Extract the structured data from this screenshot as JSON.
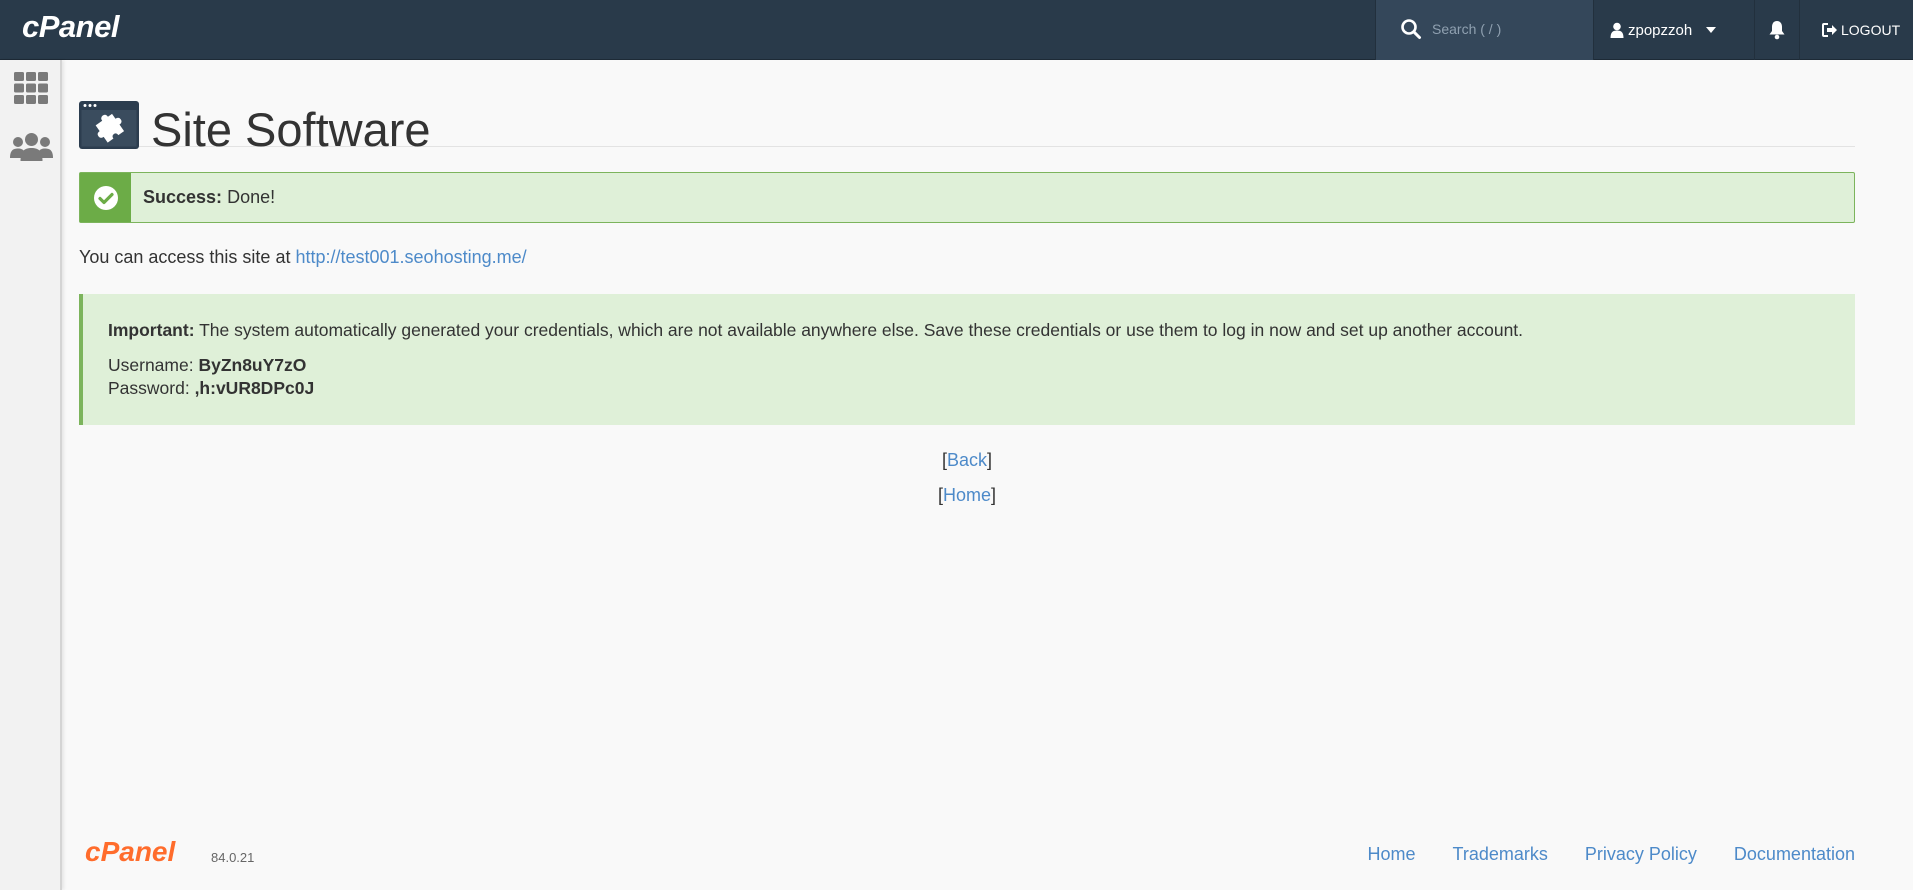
{
  "topbar": {
    "logo": "cPanel",
    "search_placeholder": "Search ( / )",
    "username": "zpopzzoh",
    "logout_label": "LOGOUT"
  },
  "sidebar": {
    "items": [
      {
        "name": "apps-grid-icon"
      },
      {
        "name": "users-icon"
      }
    ]
  },
  "page": {
    "title": "Site Software"
  },
  "success_alert": {
    "strong": "Success:",
    "text": " Done!"
  },
  "access": {
    "prefix": "You can access this site at ",
    "url": "http://test001.seohosting.me/"
  },
  "important_alert": {
    "strong": "Important:",
    "text": " The system automatically generated your credentials, which are not available anywhere else. Save these credentials or use them to log in now and set up another account.",
    "username_label": "Username: ",
    "username_value": "ByZn8uY7zO",
    "password_label": "Password: ",
    "password_value": ",h:vUR8DPc0J"
  },
  "links": {
    "back": "Back",
    "home": "Home"
  },
  "footer": {
    "logo": "cPanel",
    "version": "84.0.21",
    "links": [
      "Home",
      "Trademarks",
      "Privacy Policy",
      "Documentation"
    ]
  },
  "colors": {
    "topbar": "#293a4a",
    "success_green": "#6cac47",
    "alert_bg": "#dff0d8",
    "link": "#4d8ac9",
    "brand_orange": "#ff6c2c"
  }
}
